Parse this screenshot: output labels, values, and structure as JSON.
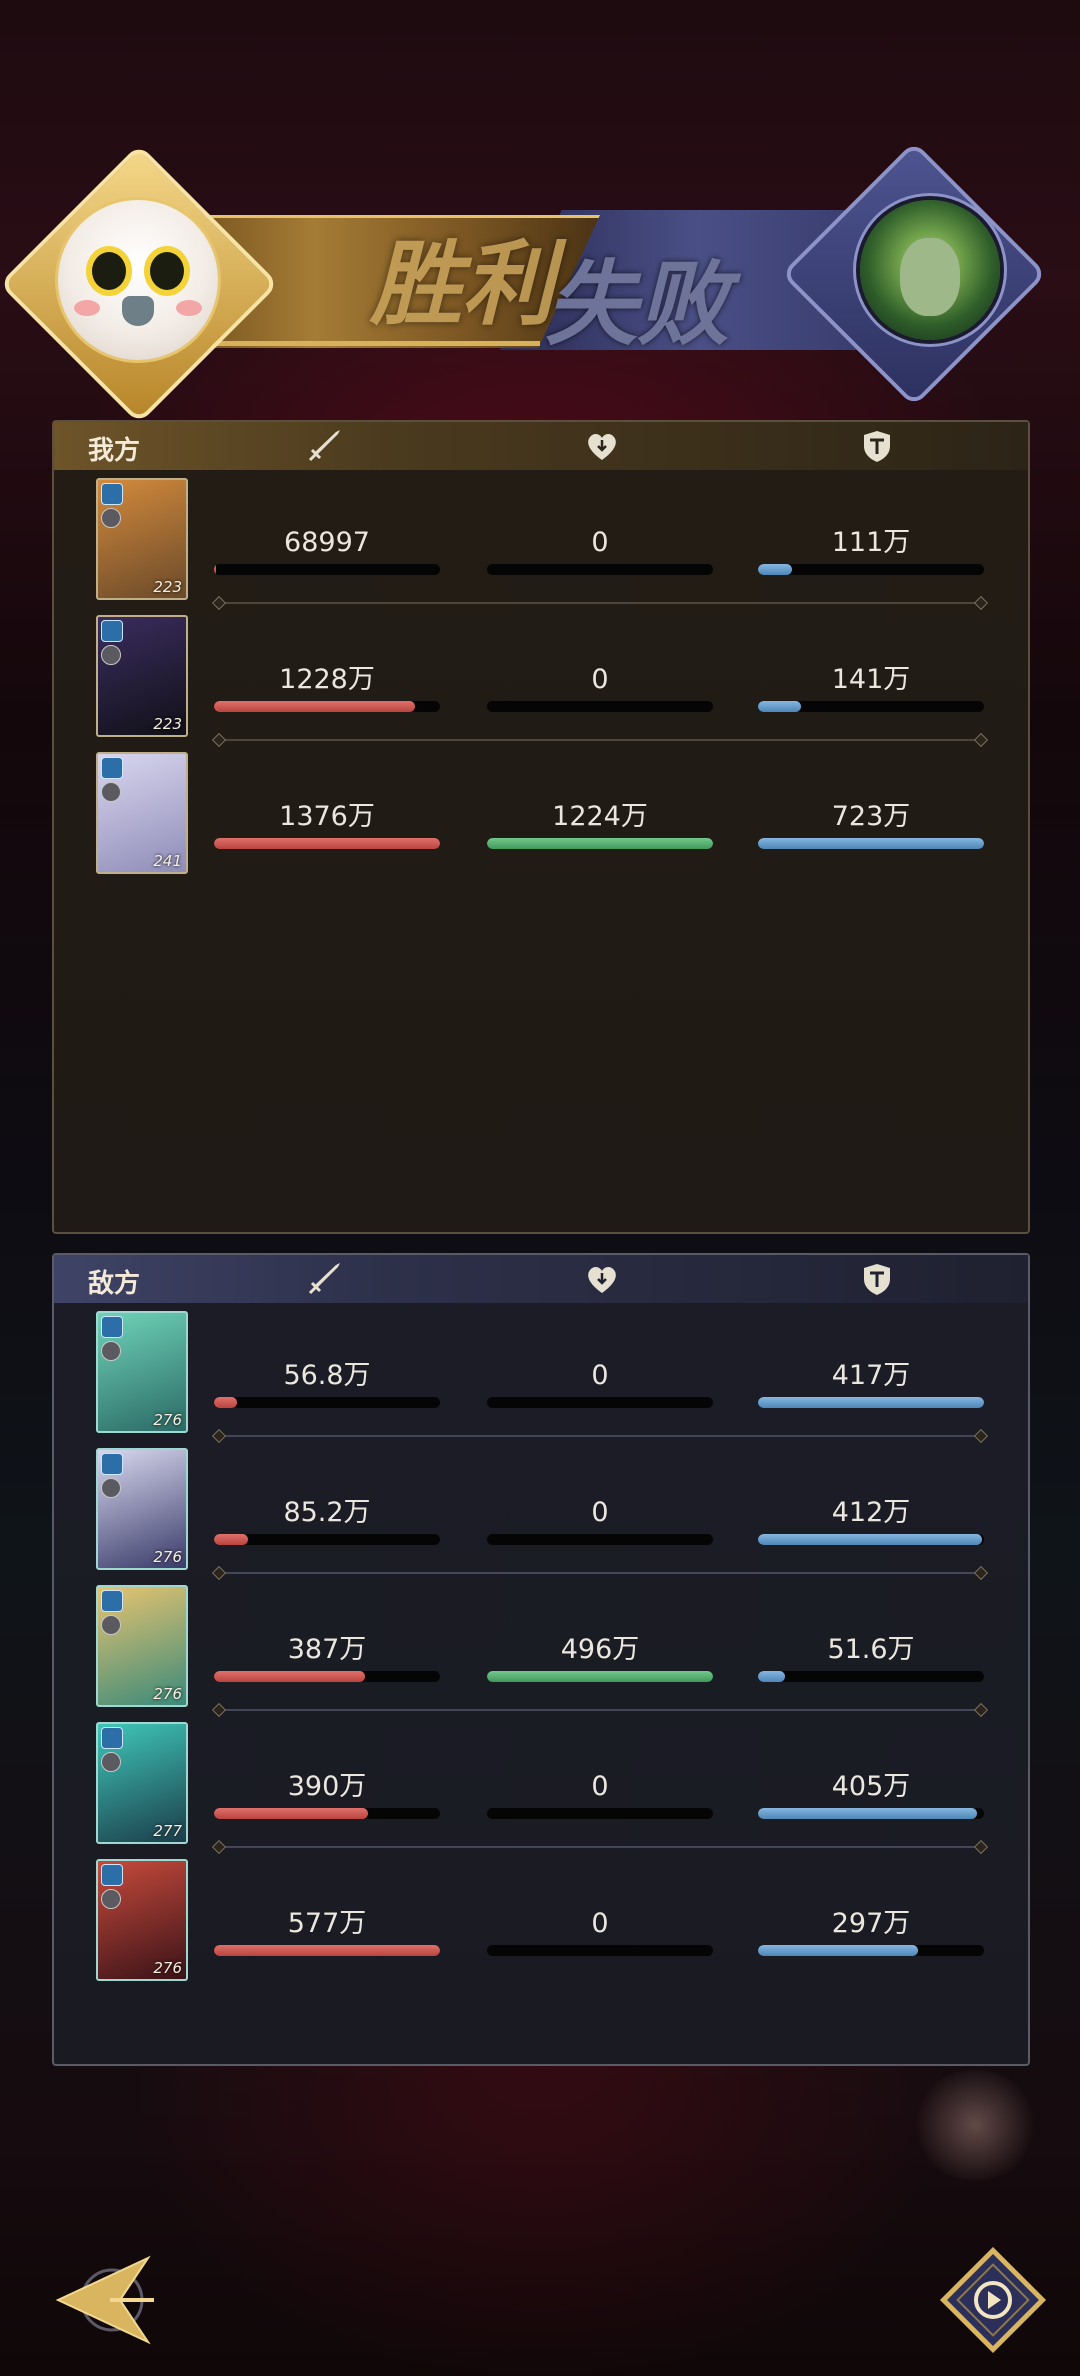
{
  "banner": {
    "win_label": "胜利",
    "lose_label": "失败"
  },
  "our_side": {
    "label": "我方",
    "rows": [
      {
        "level": "223",
        "damage": "68997",
        "damage_pct": 0.01,
        "heal": "0",
        "heal_pct": 0,
        "tank": "111万",
        "tank_pct": 0.15,
        "card_colors": [
          "#d28a3c",
          "#6b4a2a"
        ]
      },
      {
        "level": "223",
        "damage": "1228万",
        "damage_pct": 0.89,
        "heal": "0",
        "heal_pct": 0,
        "tank": "141万",
        "tank_pct": 0.19,
        "card_colors": [
          "#3a2d5e",
          "#111018"
        ]
      },
      {
        "level": "241",
        "damage": "1376万",
        "damage_pct": 1.0,
        "heal": "1224万",
        "heal_pct": 1.0,
        "tank": "723万",
        "tank_pct": 1.0,
        "card_colors": [
          "#d9d6ef",
          "#8f8db8"
        ]
      }
    ]
  },
  "enemy_side": {
    "label": "敌方",
    "rows": [
      {
        "level": "276",
        "damage": "56.8万",
        "damage_pct": 0.1,
        "heal": "0",
        "heal_pct": 0,
        "tank": "417万",
        "tank_pct": 1.0,
        "card_colors": [
          "#6fd3b8",
          "#2b6a66"
        ]
      },
      {
        "level": "276",
        "damage": "85.2万",
        "damage_pct": 0.15,
        "heal": "0",
        "heal_pct": 0,
        "tank": "412万",
        "tank_pct": 0.99,
        "card_colors": [
          "#d8d8ef",
          "#3a3b6a"
        ]
      },
      {
        "level": "276",
        "damage": "387万",
        "damage_pct": 0.67,
        "heal": "496万",
        "heal_pct": 1.0,
        "tank": "51.6万",
        "tank_pct": 0.12,
        "card_colors": [
          "#e7c470",
          "#3b8a7a"
        ]
      },
      {
        "level": "277",
        "damage": "390万",
        "damage_pct": 0.68,
        "heal": "0",
        "heal_pct": 0,
        "tank": "405万",
        "tank_pct": 0.97,
        "card_colors": [
          "#3fc7b9",
          "#1c3d4a"
        ]
      },
      {
        "level": "276",
        "damage": "577万",
        "damage_pct": 1.0,
        "heal": "0",
        "heal_pct": 0,
        "tank": "297万",
        "tank_pct": 0.71,
        "card_colors": [
          "#c74a3c",
          "#3a1318"
        ]
      }
    ]
  },
  "icons": {
    "damage": "sword-icon",
    "heal": "heart-icon",
    "tank": "shield-icon",
    "back": "back-arrow-icon",
    "replay": "replay-icon"
  },
  "colors": {
    "damage_bar": "#c9504b",
    "heal_bar": "#4fae6c",
    "tank_bar": "#6a9ccb"
  }
}
